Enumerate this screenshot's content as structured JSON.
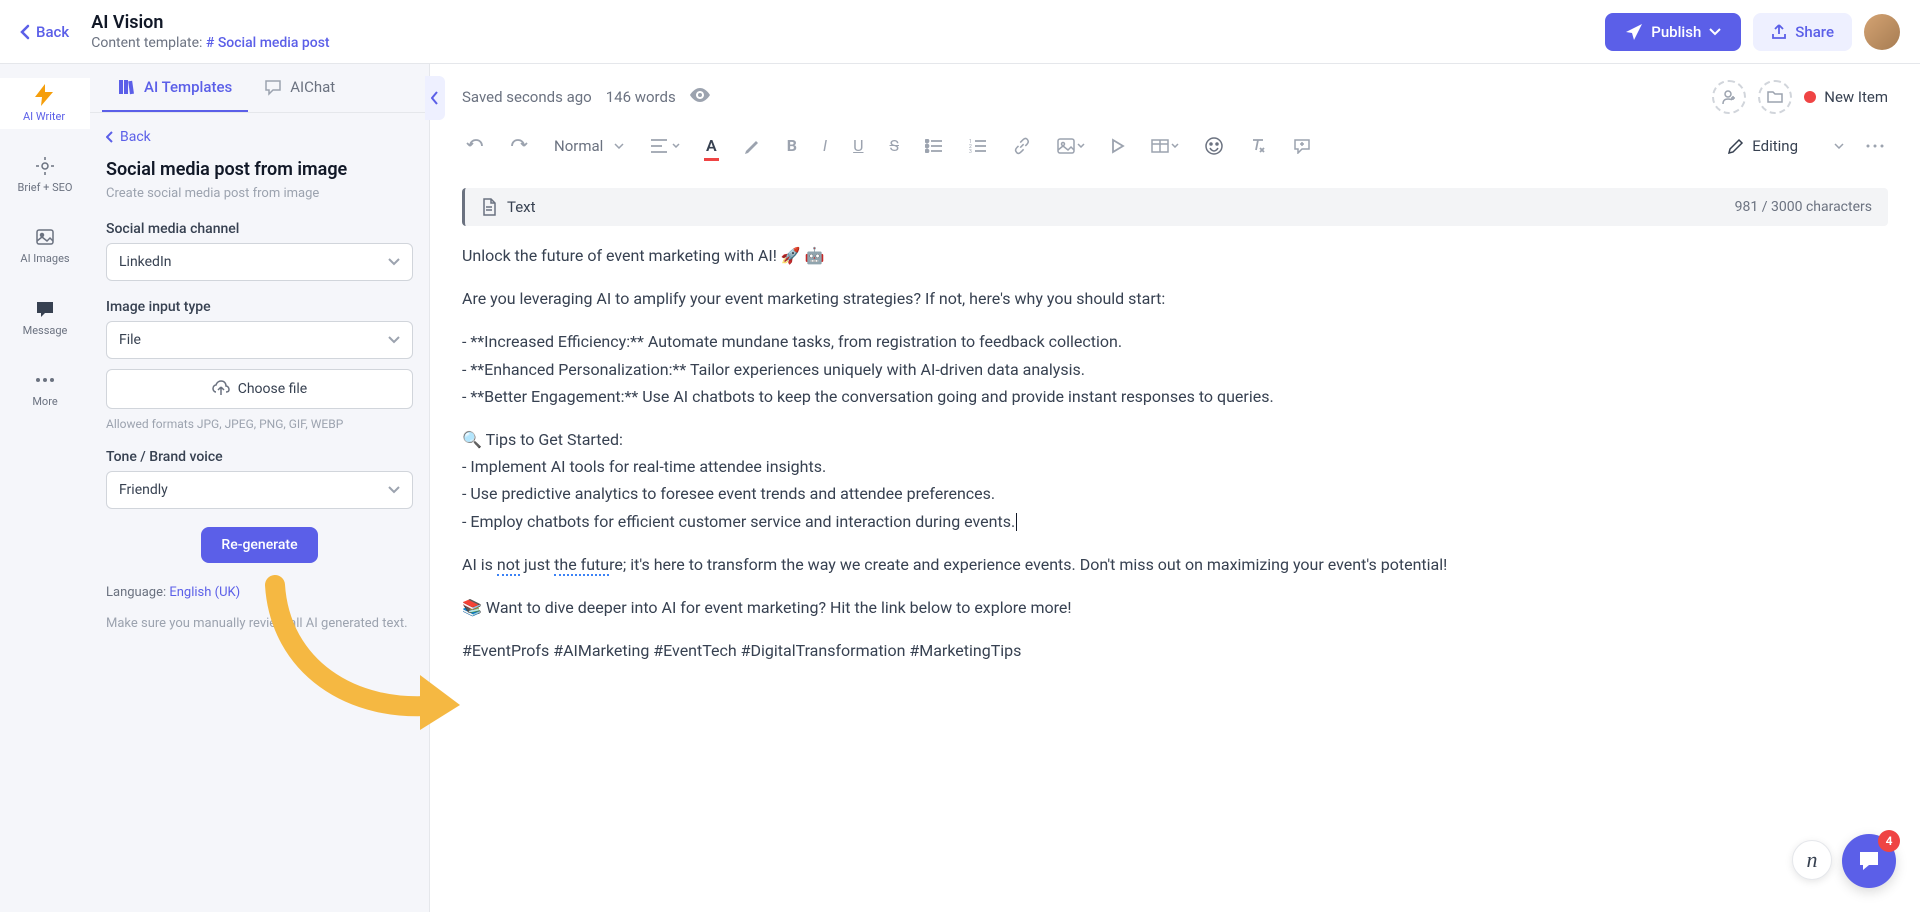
{
  "header": {
    "back": "Back",
    "title": "AI Vision",
    "template_label": "Content template:",
    "template_value": "# Social media post",
    "publish": "Publish",
    "share": "Share"
  },
  "rail": {
    "items": [
      {
        "label": "AI Writer"
      },
      {
        "label": "Brief + SEO"
      },
      {
        "label": "AI Images"
      },
      {
        "label": "Message"
      },
      {
        "label": "More"
      }
    ]
  },
  "sidebar": {
    "tabs": {
      "templates": "AI Templates",
      "chat": "AIChat"
    },
    "back": "Back",
    "panel_title": "Social media post from image",
    "panel_subtitle": "Create social media post from image",
    "channel_label": "Social media channel",
    "channel_value": "LinkedIn",
    "image_input_label": "Image input type",
    "image_input_value": "File",
    "choose_file": "Choose file",
    "formats_hint": "Allowed formats JPG, JPEG, PNG, GIF, WEBP",
    "tone_label": "Tone / Brand voice",
    "tone_value": "Friendly",
    "regenerate": "Re-generate",
    "language_label": "Language: ",
    "language_value": "English (UK)",
    "warning": "Make sure you manually review all AI generated text."
  },
  "editor": {
    "save_status": "Saved seconds ago",
    "word_count": "146 words",
    "status_label": "New Item",
    "normal": "Normal",
    "editing": "Editing",
    "text_block": "Text",
    "char_counter": "981 / 3000 characters",
    "p1": "Unlock the future of event marketing with AI! 🚀 🤖",
    "p2": "Are you leveraging AI to amplify your event marketing strategies? If not, here's why you should start:",
    "p3a": "- **Increased Efficiency:** Automate mundane tasks, from registration to feedback collection.",
    "p3b": "- **Enhanced Personalization:** Tailor experiences uniquely with AI-driven data analysis.",
    "p3c": "- **Better Engagement:** Use AI chatbots to keep the conversation going and provide instant responses to queries.",
    "p4": "🔍 Tips to Get Started:",
    "p5a": "- Implement AI tools for real-time attendee insights.",
    "p5b": "- Use predictive analytics to foresee event trends and attendee preferences.",
    "p5c": "- Employ chatbots for efficient customer service and interaction during events.",
    "p6_pre": "AI is ",
    "p6_err1": "not",
    "p6_mid1": " just ",
    "p6_err2": "the futu",
    "p6_post": "re; it's here to transform the way we create and experience events. Don't miss out on maximizing your event's potential!",
    "p7": "📚 Want to dive deeper into AI for event marketing? Hit the link below to explore more!",
    "p8": "#EventProfs #AIMarketing #EventTech #DigitalTransformation #MarketingTips"
  },
  "chat": {
    "badge": "4"
  }
}
